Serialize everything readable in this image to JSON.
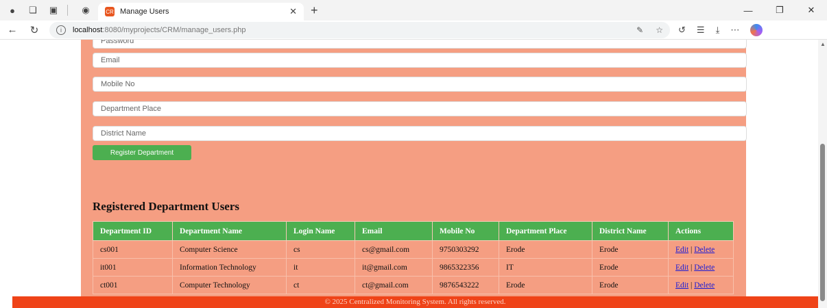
{
  "browser": {
    "tab": {
      "favicon": "CR",
      "title": "Manage Users"
    },
    "url_host": "localhost",
    "url_rest": ":8080/myprojects/CRM/manage_users.php"
  },
  "form": {
    "fields": [
      {
        "placeholder": "Password"
      },
      {
        "placeholder": "Email"
      },
      {
        "placeholder": "Mobile No"
      },
      {
        "placeholder": "Department Place"
      },
      {
        "placeholder": "District Name"
      }
    ],
    "submit_label": "Register Department"
  },
  "table": {
    "title": "Registered Department Users",
    "headers": [
      "Department ID",
      "Department Name",
      "Login Name",
      "Email",
      "Mobile No",
      "Department Place",
      "District Name",
      "Actions"
    ],
    "rows": [
      {
        "id": "cs001",
        "name": "Computer Science",
        "login": "cs",
        "email": "cs@gmail.com",
        "mobile": "9750303292",
        "place": "Erode",
        "district": "Erode"
      },
      {
        "id": "it001",
        "name": "Information Technology",
        "login": "it",
        "email": "it@gmail.com",
        "mobile": "9865322356",
        "place": "IT",
        "district": "Erode"
      },
      {
        "id": "ct001",
        "name": "Computer Technology",
        "login": "ct",
        "email": "ct@gmail.com",
        "mobile": "9876543222",
        "place": "Erode",
        "district": "Erode"
      }
    ],
    "edit_label": "Edit",
    "separator": " | ",
    "delete_label": "Delete"
  },
  "footer": {
    "text": "© 2025 Centralized Monitoring System. All rights reserved."
  },
  "colors": {
    "card_bg": "#f59e82",
    "button_green": "#4caf50",
    "footer_bg": "#ef4318"
  }
}
